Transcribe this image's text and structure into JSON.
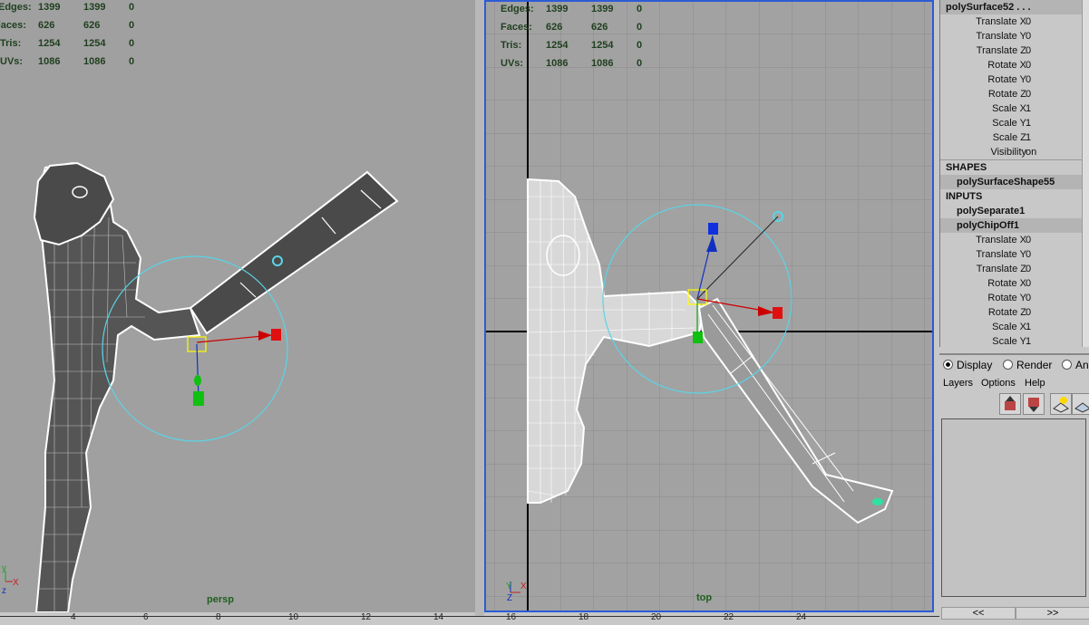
{
  "left_viewport": {
    "hud": [
      {
        "label": "Edges:",
        "v1": "1399",
        "v2": "1399",
        "v3": "0"
      },
      {
        "label": "Faces:",
        "v1": "626",
        "v2": "626",
        "v3": "0"
      },
      {
        "label": "Tris:",
        "v1": "1254",
        "v2": "1254",
        "v3": "0"
      },
      {
        "label": "UVs:",
        "v1": "1086",
        "v2": "1086",
        "v3": "0"
      }
    ],
    "camera": "persp"
  },
  "right_viewport": {
    "hud": [
      {
        "label": "Edges:",
        "v1": "1399",
        "v2": "1399",
        "v3": "0"
      },
      {
        "label": "Faces:",
        "v1": "626",
        "v2": "626",
        "v3": "0"
      },
      {
        "label": "Tris:",
        "v1": "1254",
        "v2": "1254",
        "v3": "0"
      },
      {
        "label": "UVs:",
        "v1": "1086",
        "v2": "1086",
        "v3": "0"
      }
    ],
    "camera": "top"
  },
  "ruler_ticks": [
    "4",
    "6",
    "8",
    "10",
    "12",
    "14",
    "16",
    "18",
    "20",
    "22",
    "24"
  ],
  "channel_box": {
    "object": "polySurface52 . . .",
    "attributes": [
      {
        "label": "Translate X",
        "value": "0"
      },
      {
        "label": "Translate Y",
        "value": "0"
      },
      {
        "label": "Translate Z",
        "value": "0"
      },
      {
        "label": "Rotate X",
        "value": "0"
      },
      {
        "label": "Rotate Y",
        "value": "0"
      },
      {
        "label": "Rotate Z",
        "value": "0"
      },
      {
        "label": "Scale X",
        "value": "1"
      },
      {
        "label": "Scale Y",
        "value": "1"
      },
      {
        "label": "Scale Z",
        "value": "1"
      },
      {
        "label": "Visibility",
        "value": "on"
      }
    ],
    "shapes_header": "SHAPES",
    "shape": "polySurfaceShape55",
    "inputs_header": "INPUTS",
    "inputs": [
      "polySeparate1",
      "polyChipOff1"
    ],
    "input_attributes": [
      {
        "label": "Translate X",
        "value": "0"
      },
      {
        "label": "Translate Y",
        "value": "0"
      },
      {
        "label": "Translate Z",
        "value": "0"
      },
      {
        "label": "Rotate X",
        "value": "0"
      },
      {
        "label": "Rotate Y",
        "value": "0"
      },
      {
        "label": "Rotate Z",
        "value": "0"
      },
      {
        "label": "Scale X",
        "value": "1"
      },
      {
        "label": "Scale Y",
        "value": "1"
      }
    ]
  },
  "layer_editor": {
    "modes": [
      "Display",
      "Render",
      "An"
    ],
    "selected_mode": "Display",
    "menus": [
      "Layers",
      "Options",
      "Help"
    ],
    "pager_prev": "<<",
    "pager_next": ">>"
  },
  "colors": {
    "selection_border": "#2c5bd4",
    "viewport_bg": "#a0a0a0",
    "manip_circle": "#5ad4e6"
  }
}
